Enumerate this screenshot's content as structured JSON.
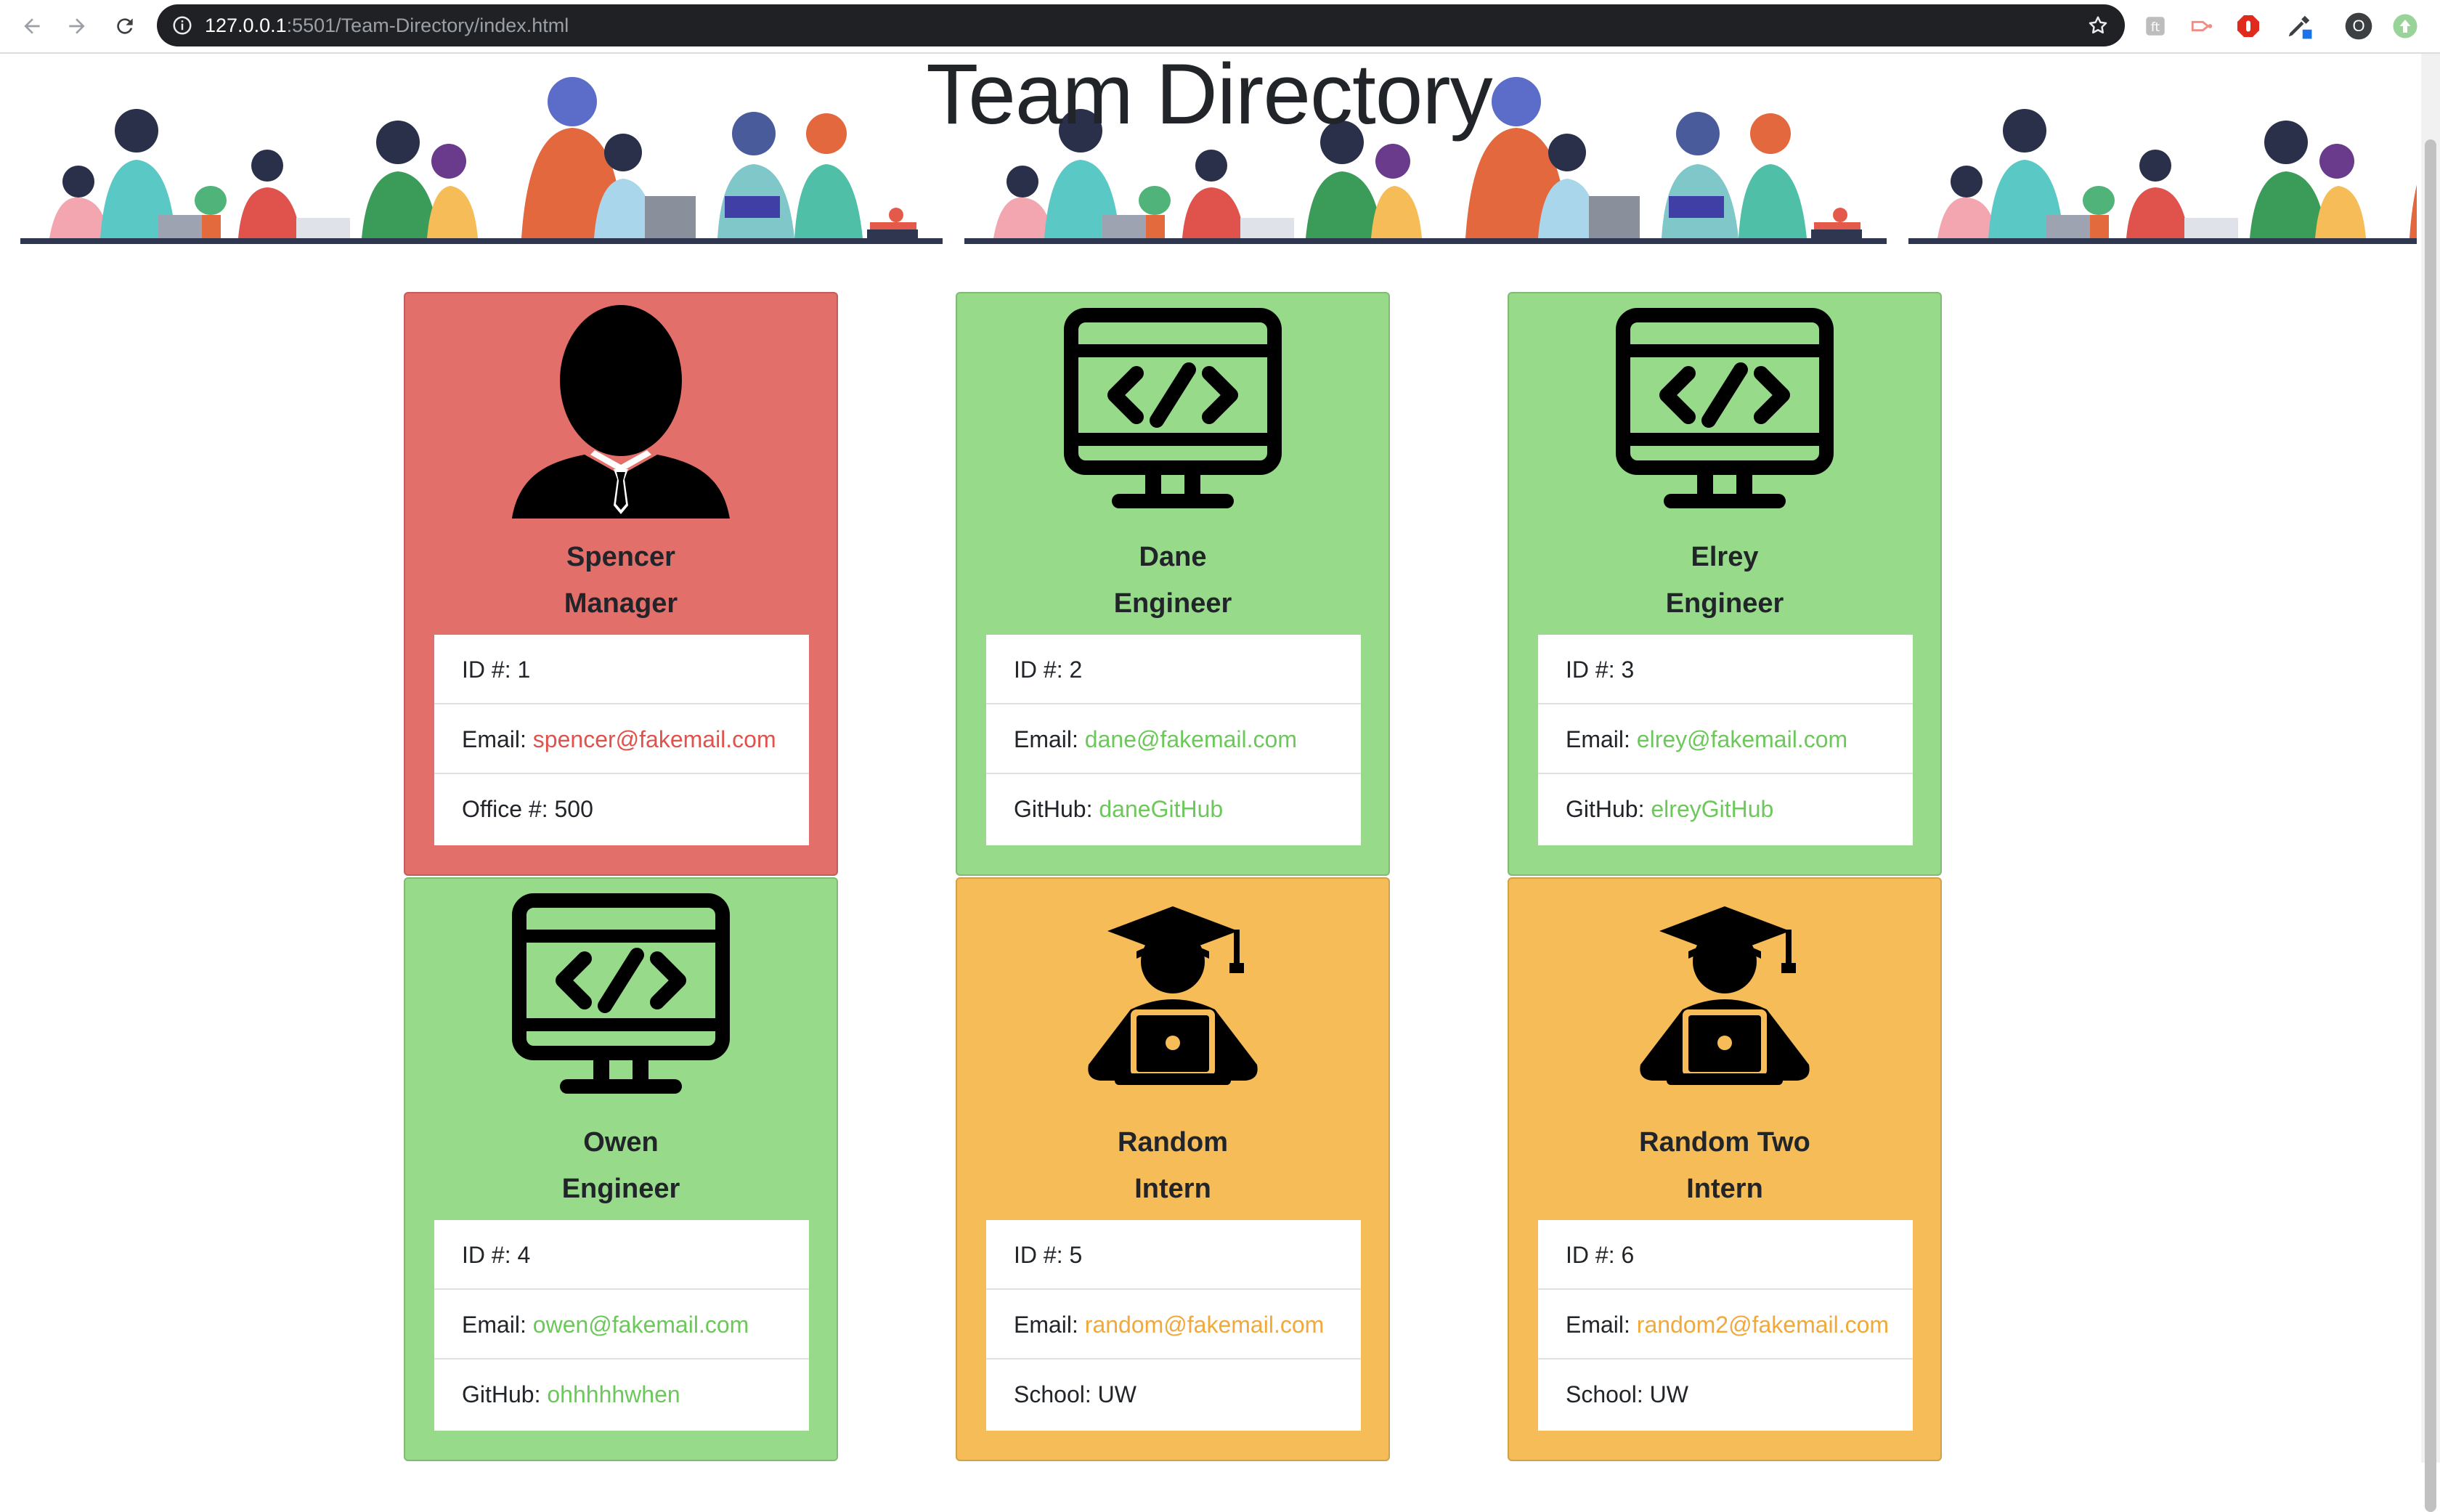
{
  "browser": {
    "url_host": "127.0.0.1",
    "url_path": ":5501/Team-Directory/index.html",
    "profile_initial": "O"
  },
  "page": {
    "title": "Team Directory",
    "labels": {
      "id": "ID #: ",
      "email": "Email: ",
      "office": "Office #: ",
      "github": "GitHub: ",
      "school": "School: "
    }
  },
  "team": [
    {
      "name": "Spencer",
      "role": "Manager",
      "id": "1",
      "email": "spencer@fakemail.com",
      "extra_label": "Office #: ",
      "extra_value": "500",
      "icon": "manager-icon",
      "color": "#e36f6b"
    },
    {
      "name": "Dane",
      "role": "Engineer",
      "id": "2",
      "email": "dane@fakemail.com",
      "extra_label": "GitHub: ",
      "extra_value": "daneGitHub",
      "icon": "code-monitor-icon",
      "color": "#97db8a"
    },
    {
      "name": "Elrey",
      "role": "Engineer",
      "id": "3",
      "email": "elrey@fakemail.com",
      "extra_label": "GitHub: ",
      "extra_value": "elreyGitHub",
      "icon": "code-monitor-icon",
      "color": "#97db8a"
    },
    {
      "name": "Owen",
      "role": "Engineer",
      "id": "4",
      "email": "owen@fakemail.com",
      "extra_label": "GitHub: ",
      "extra_value": "ohhhhhwhen",
      "icon": "code-monitor-icon",
      "color": "#97db8a"
    },
    {
      "name": "Random",
      "role": "Intern",
      "id": "5",
      "email": "random@fakemail.com",
      "extra_label": "School: ",
      "extra_value": "UW",
      "icon": "graduate-laptop-icon",
      "color": "#f5bc58"
    },
    {
      "name": "Random Two",
      "role": "Intern",
      "id": "6",
      "email": "random2@fakemail.com",
      "extra_label": "School: ",
      "extra_value": "UW",
      "icon": "graduate-laptop-icon",
      "color": "#f5bc58"
    }
  ]
}
